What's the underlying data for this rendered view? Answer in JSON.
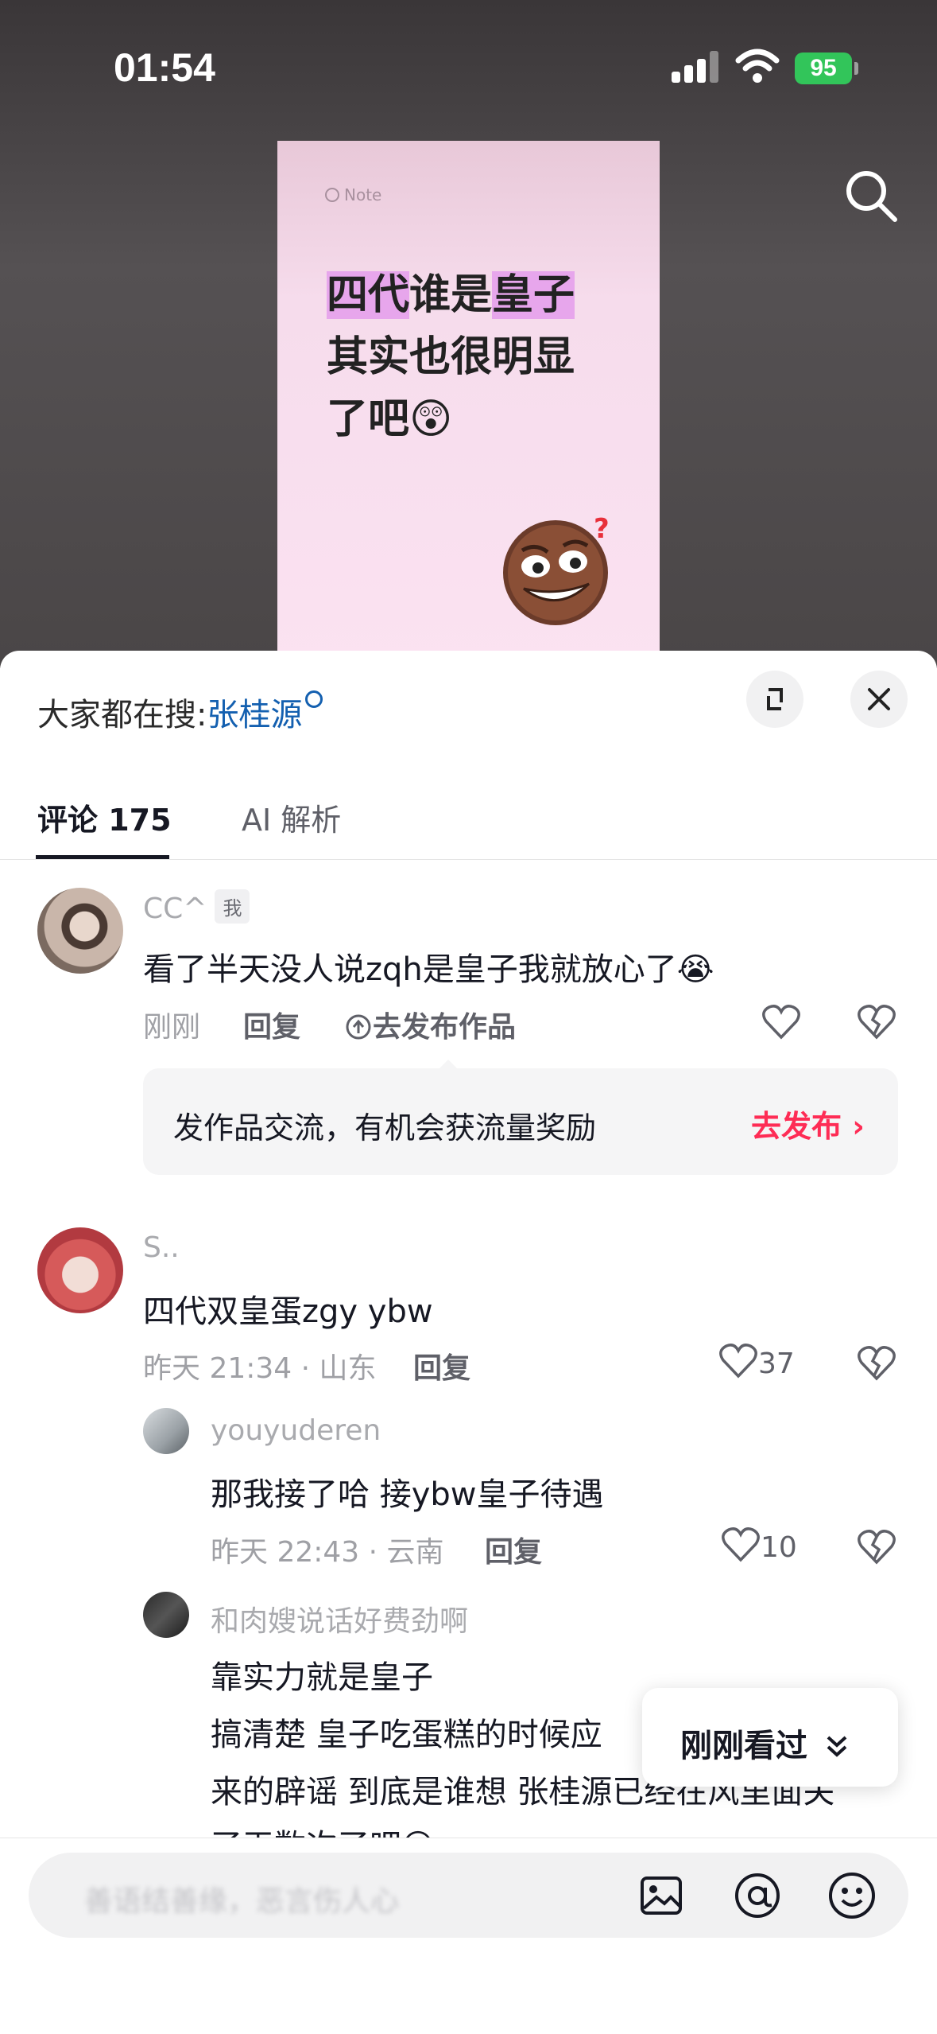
{
  "status_bar": {
    "time": "01:54",
    "battery": "95"
  },
  "video": {
    "note_label": "Note",
    "line1_hl1": "四代",
    "line1_mid": "谁是",
    "line1_hl2": "皇子",
    "line2": "其实也很明显",
    "line3": "了吧😲"
  },
  "search_bar": {
    "prefix": "大家都在搜:",
    "query": "张桂源"
  },
  "tabs": [
    {
      "label": "评论 175",
      "active": true
    },
    {
      "label": "AI 解析",
      "active": false
    }
  ],
  "comments": [
    {
      "user": "CC^",
      "badge": "我",
      "text": "看了半天没人说zqh是皇子我就放心了😭",
      "time": "刚刚",
      "reply_label": "回复",
      "publish_label": "去发布作品"
    },
    {
      "user": "S..",
      "text": "四代双皇蛋zgy ybw",
      "time": "昨天 21:34 · 山东",
      "reply_label": "回复",
      "likes": "37"
    }
  ],
  "replies": [
    {
      "user": "youyuderen",
      "text": "那我接了哈 接ybw皇子待遇",
      "time": "昨天 22:43 · 云南",
      "reply_label": "回复",
      "likes": "10"
    },
    {
      "user": "和肉嫂说话好费劲啊",
      "lines": [
        "靠实力就是皇子",
        "搞清楚 皇子吃蛋糕的时候应",
        "来的辟谣 到底是谁想 张桂源已经在风里面关",
        "了天数次了吧😮"
      ]
    }
  ],
  "promo": {
    "text": "发作品交流，有机会获流量奖励",
    "link": "去发布"
  },
  "popup": {
    "label": "刚刚看过"
  },
  "input": {
    "placeholder": "善语结善缘，恶言伤人心"
  },
  "colors": {
    "accent": "#fe2c55",
    "link": "#1460b0",
    "battery": "#32c55a"
  }
}
